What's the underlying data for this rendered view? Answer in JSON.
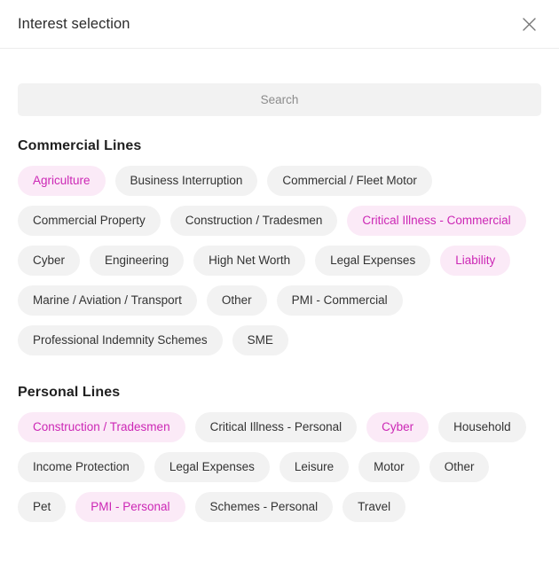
{
  "header": {
    "title": "Interest selection",
    "close_icon": "close-icon",
    "close_label": "Close"
  },
  "search": {
    "placeholder": "Search",
    "value": "",
    "icon": "search-icon"
  },
  "colors": {
    "chip_bg": "#f2f2f2",
    "chip_text": "#333333",
    "chip_selected_bg": "#fbeaf7",
    "chip_selected_text": "#cc27b5",
    "search_bg": "#f2f2f2",
    "divider": "#ececec",
    "page_bg": "#ffffff"
  },
  "sections": [
    {
      "title": "Commercial Lines",
      "chips": [
        {
          "label": "Agriculture",
          "selected": true
        },
        {
          "label": "Business Interruption",
          "selected": false
        },
        {
          "label": "Commercial / Fleet Motor",
          "selected": false
        },
        {
          "label": "Commercial Property",
          "selected": false
        },
        {
          "label": "Construction / Tradesmen",
          "selected": false
        },
        {
          "label": "Critical Illness - Commercial",
          "selected": true
        },
        {
          "label": "Cyber",
          "selected": false
        },
        {
          "label": "Engineering",
          "selected": false
        },
        {
          "label": "High Net Worth",
          "selected": false
        },
        {
          "label": "Legal Expenses",
          "selected": false
        },
        {
          "label": "Liability",
          "selected": true
        },
        {
          "label": "Marine / Aviation / Transport",
          "selected": false
        },
        {
          "label": "Other",
          "selected": false
        },
        {
          "label": "PMI - Commercial",
          "selected": false
        },
        {
          "label": "Professional Indemnity Schemes",
          "selected": false
        },
        {
          "label": "SME",
          "selected": false
        }
      ]
    },
    {
      "title": "Personal Lines",
      "chips": [
        {
          "label": "Construction / Tradesmen",
          "selected": true
        },
        {
          "label": "Critical Illness - Personal",
          "selected": false
        },
        {
          "label": "Cyber",
          "selected": true
        },
        {
          "label": "Household",
          "selected": false
        },
        {
          "label": "Income Protection",
          "selected": false
        },
        {
          "label": "Legal Expenses",
          "selected": false
        },
        {
          "label": "Leisure",
          "selected": false
        },
        {
          "label": "Motor",
          "selected": false
        },
        {
          "label": "Other",
          "selected": false
        },
        {
          "label": "Pet",
          "selected": false
        },
        {
          "label": "PMI - Personal",
          "selected": true
        },
        {
          "label": "Schemes - Personal",
          "selected": false
        },
        {
          "label": "Travel",
          "selected": false
        }
      ]
    }
  ]
}
